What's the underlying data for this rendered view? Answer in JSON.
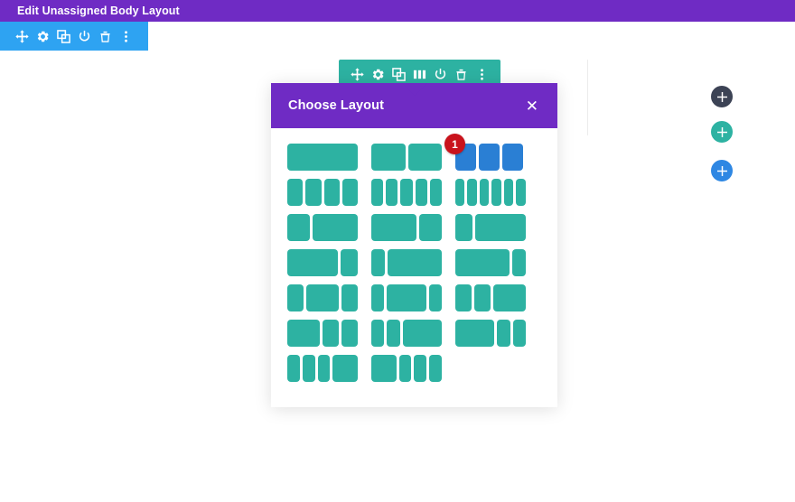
{
  "admin_bar": {
    "title": "Edit Unassigned Body Layout",
    "background": "#6f2bc4"
  },
  "section_toolbar": {
    "background": "#2ea3f2",
    "icons": [
      {
        "name": "move-icon",
        "label": "Move Section"
      },
      {
        "name": "gear-icon",
        "label": "Section Settings"
      },
      {
        "name": "duplicate-icon",
        "label": "Duplicate Section"
      },
      {
        "name": "power-icon",
        "label": "Disable Section"
      },
      {
        "name": "trash-icon",
        "label": "Delete Section"
      },
      {
        "name": "more-options-icon",
        "label": "Other Options"
      }
    ]
  },
  "row_toolbar": {
    "background": "#2db2a2",
    "icons": [
      {
        "name": "move-icon",
        "label": "Move Row"
      },
      {
        "name": "gear-icon",
        "label": "Row Settings"
      },
      {
        "name": "duplicate-icon",
        "label": "Duplicate Row"
      },
      {
        "name": "column-layout-icon",
        "label": "Change Column Structure",
        "active": true
      },
      {
        "name": "power-icon",
        "label": "Disable Row"
      },
      {
        "name": "trash-icon",
        "label": "Delete Row"
      },
      {
        "name": "more-options-icon",
        "label": "Other Options"
      }
    ]
  },
  "modal": {
    "title": "Choose Layout",
    "close_label": "✕",
    "accent": "#6f2bc4",
    "column_color": "#2db2a2",
    "selected_color": "#2a7fd4",
    "badge_color": "#c9131c",
    "selected_badge": "1",
    "rows": [
      {
        "options": [
          {
            "name": "layout-1-column",
            "widths": [
              100
            ],
            "selected": false
          },
          {
            "name": "layout-2-column",
            "widths": [
              50,
              50
            ],
            "selected": false
          },
          {
            "name": "layout-3-column",
            "widths": [
              33.33,
              33.33,
              33.33
            ],
            "selected": true,
            "badge": "1"
          }
        ]
      },
      {
        "options": [
          {
            "name": "layout-4-column",
            "widths": [
              25,
              25,
              25,
              25
            ],
            "selected": false
          },
          {
            "name": "layout-5-column",
            "widths": [
              20,
              20,
              20,
              20,
              20
            ],
            "selected": false
          },
          {
            "name": "layout-6-column",
            "widths": [
              16.6,
              16.6,
              16.6,
              16.6,
              16.6,
              16.6
            ],
            "selected": false
          }
        ]
      },
      {
        "options": [
          {
            "name": "layout-1-3-2-3",
            "widths": [
              33.33,
              66.66
            ],
            "selected": false
          },
          {
            "name": "layout-2-3-1-3",
            "widths": [
              66.66,
              33.33
            ],
            "selected": false
          },
          {
            "name": "layout-1-4-3-4",
            "widths": [
              25,
              75
            ],
            "selected": false
          }
        ]
      },
      {
        "options": [
          {
            "name": "layout-3-4-1-4",
            "widths": [
              75,
              25
            ],
            "selected": false
          },
          {
            "name": "layout-1-5-4-5",
            "widths": [
              20,
              80
            ],
            "selected": false
          },
          {
            "name": "layout-4-5-1-5",
            "widths": [
              80,
              20
            ],
            "selected": false
          }
        ]
      },
      {
        "options": [
          {
            "name": "layout-1-4-1-2-1-4",
            "widths": [
              25,
              50,
              25
            ],
            "selected": false
          },
          {
            "name": "layout-1-5-3-5-1-5",
            "widths": [
              20,
              60,
              20
            ],
            "selected": false
          },
          {
            "name": "layout-1-4-1-4-1-2",
            "widths": [
              25,
              25,
              50
            ],
            "selected": false
          }
        ]
      },
      {
        "options": [
          {
            "name": "layout-1-2-1-4-1-4",
            "widths": [
              50,
              25,
              25
            ],
            "selected": false
          },
          {
            "name": "layout-1-5-1-5-3-5",
            "widths": [
              20,
              20,
              60
            ],
            "selected": false
          },
          {
            "name": "layout-3-5-1-5-1-5",
            "widths": [
              60,
              20,
              20
            ],
            "selected": false
          }
        ]
      },
      {
        "options": [
          {
            "name": "layout-1-5-1-5-1-5-2-5",
            "widths": [
              20,
              20,
              20,
              40
            ],
            "selected": false
          },
          {
            "name": "layout-2-5-1-5-1-5-1-5",
            "widths": [
              40,
              20,
              20,
              20
            ],
            "selected": false
          }
        ]
      }
    ]
  },
  "add_buttons": [
    {
      "name": "add-section-button",
      "label": "+",
      "color": "#3c4355"
    },
    {
      "name": "add-row-button",
      "label": "+",
      "color": "#2db2a2"
    },
    {
      "name": "add-module-button",
      "label": "+",
      "color": "#2e87e3"
    }
  ]
}
